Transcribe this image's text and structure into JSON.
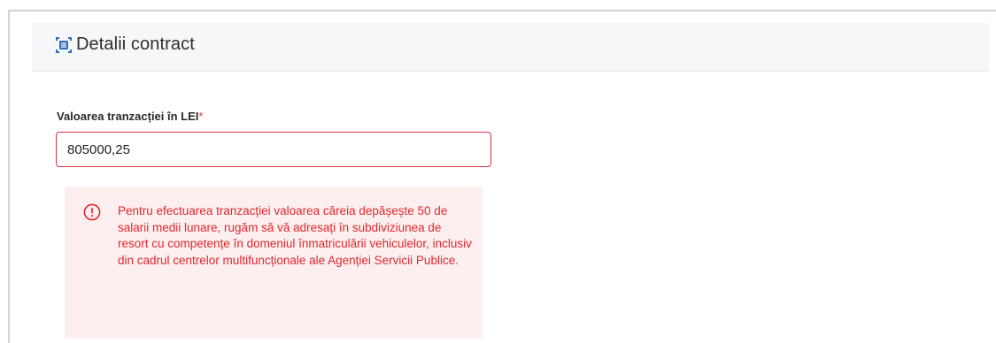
{
  "section": {
    "title": "Detalii contract",
    "icon": "document-list-icon"
  },
  "field": {
    "label": "Valoarea tranzacției în LEI",
    "required_marker": "*",
    "value": "805000,25"
  },
  "error": {
    "icon": "exclamation-circle-icon",
    "message": "Pentru efectuarea tranzacției valoarea căreia depășește 50 de salarii medii lunare, rugăm să vă adresați în subdiviziunea de resort cu competențe în domeniul înmatriculării vehiculelor, inclusiv din cadrul centrelor multifuncționale ale Agenției Servicii Publice."
  },
  "colors": {
    "accent": "#2f6fb5",
    "error": "#e0282e",
    "error_background": "#fdefef",
    "header_background": "#f5f7f9"
  }
}
